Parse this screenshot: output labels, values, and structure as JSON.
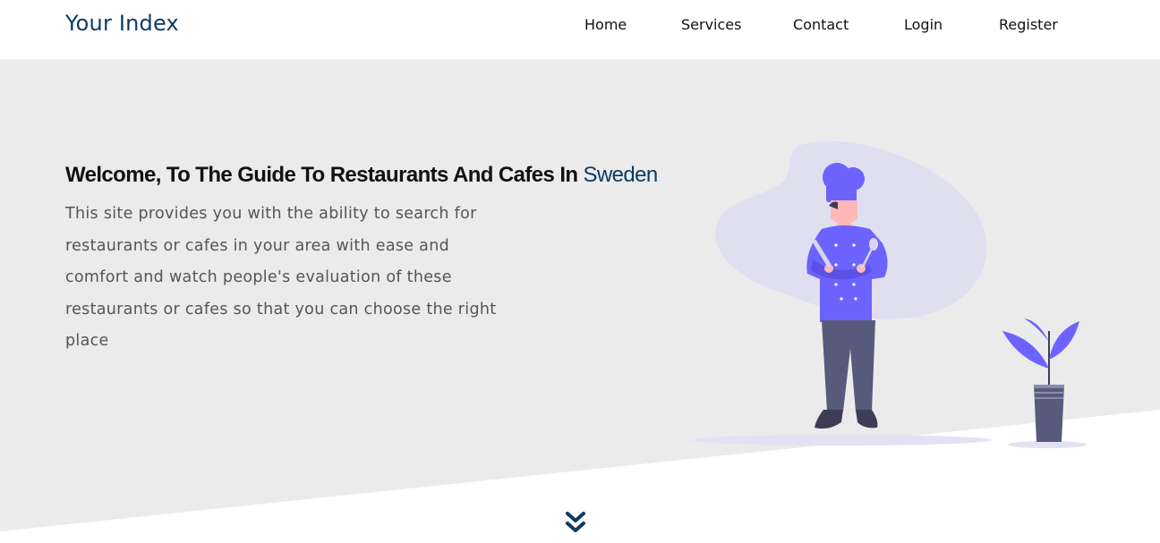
{
  "brand": {
    "name": "Your Index"
  },
  "nav": {
    "home": "Home",
    "services": "Services",
    "contact": "Contact",
    "login": "Login",
    "register": "Register"
  },
  "hero": {
    "title_prefix": "Welcome, To The Guide To Restaurants And Cafes In ",
    "title_accent": "Sweden",
    "description": "This site provides you with the ability to search for restaurants or cafes in your area with ease and comfort and watch people's evaluation of these restaurants or cafes so that you can choose the right place",
    "illustration_icon": "chef-illustration"
  },
  "scroll": {
    "icon": "double-chevron-down-icon"
  },
  "colors": {
    "brand": "#0c3b63",
    "hero_bg": "#ebebeb",
    "illustration_accent": "#6c63ff",
    "illustration_blob": "#e0dff0"
  }
}
